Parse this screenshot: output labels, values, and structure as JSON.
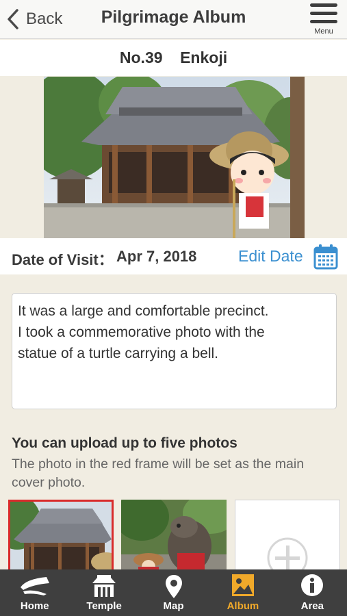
{
  "nav": {
    "back_label": "Back",
    "title": "Pilgrimage Album",
    "menu_label": "Menu"
  },
  "temple": {
    "header": "No.39    Enkoji"
  },
  "visit": {
    "label": "Date of Visit：",
    "date": "Apr 7, 2018",
    "edit_label": "Edit Date"
  },
  "note": {
    "lines": [
      "It was a large and comfortable precinct.",
      "I took a commemorative photo with the",
      "statue of a turtle carrying a bell."
    ]
  },
  "upload": {
    "title": "You can upload up to five photos",
    "subtitle": "The photo in the red frame will be set as the main cover photo."
  },
  "tabs": [
    {
      "label": "Home",
      "icon": "home-icon"
    },
    {
      "label": "Temple",
      "icon": "temple-icon"
    },
    {
      "label": "Map",
      "icon": "map-pin-icon"
    },
    {
      "label": "Album",
      "icon": "album-icon"
    },
    {
      "label": "Area",
      "icon": "info-icon"
    }
  ],
  "colors": {
    "accent_blue": "#3a8fd0",
    "main_photo_frame": "#d92b2b",
    "active_tab": "#f0a92a",
    "tabbar_bg": "#3f3f3f"
  }
}
